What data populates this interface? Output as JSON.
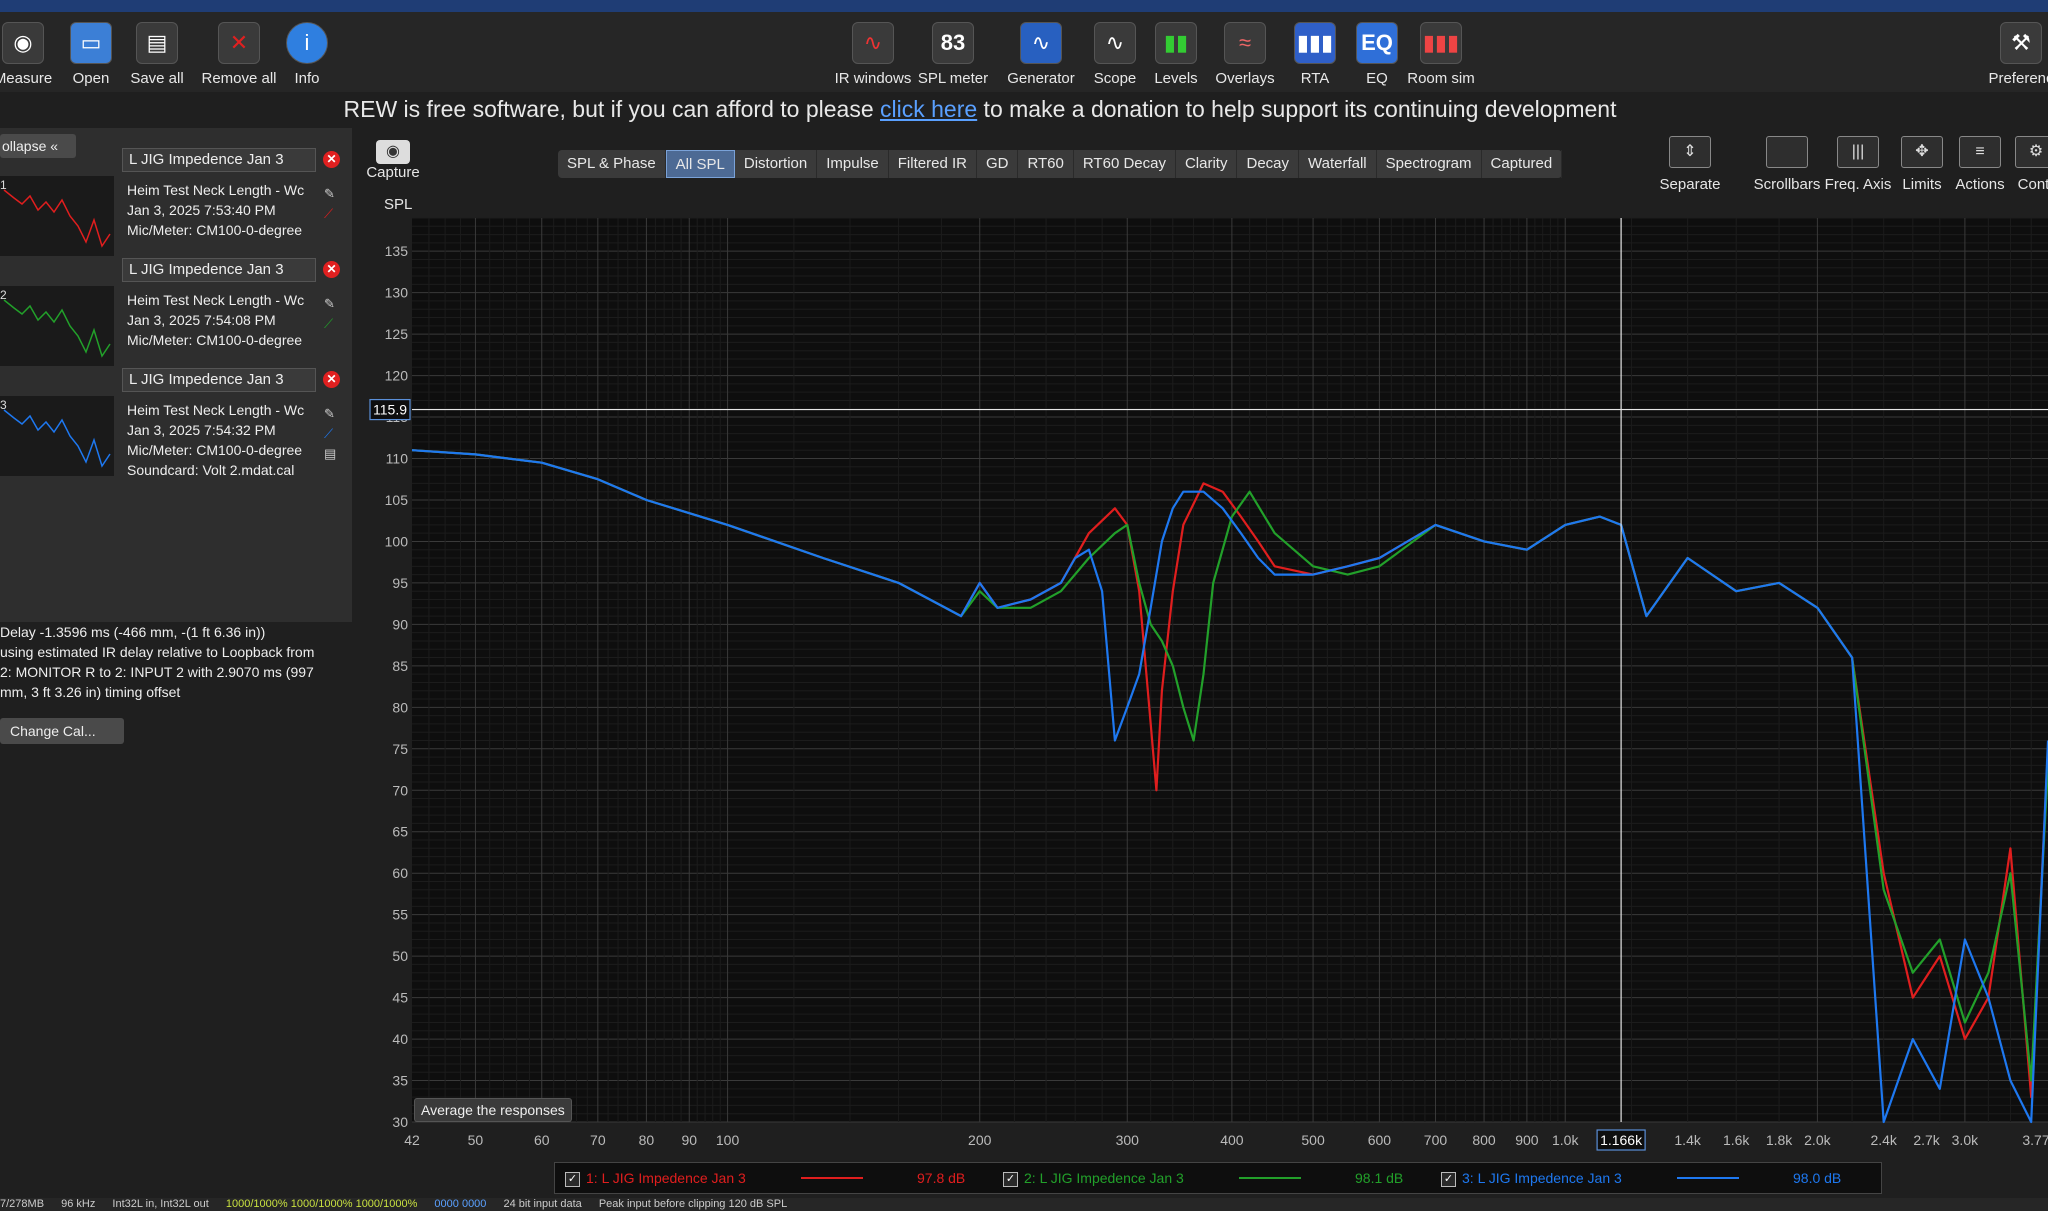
{
  "toolbar": {
    "left": [
      {
        "label": "Measure",
        "icon": "measure-icon"
      },
      {
        "label": "Open",
        "icon": "folder-icon"
      },
      {
        "label": "Save all",
        "icon": "save-icon"
      },
      {
        "label": "Remove all",
        "icon": "remove-icon"
      },
      {
        "label": "Info",
        "icon": "info-icon"
      }
    ],
    "center": [
      {
        "label": "IR windows",
        "icon": "ir-windows-icon"
      },
      {
        "label": "SPL meter",
        "icon": "spl-meter-icon",
        "value": "83"
      },
      {
        "label": "Generator",
        "icon": "generator-icon"
      },
      {
        "label": "Scope",
        "icon": "scope-icon"
      },
      {
        "label": "Levels",
        "icon": "levels-icon"
      },
      {
        "label": "Overlays",
        "icon": "overlays-icon"
      },
      {
        "label": "RTA",
        "icon": "rta-icon"
      },
      {
        "label": "EQ",
        "icon": "eq-icon"
      },
      {
        "label": "Room sim",
        "icon": "room-sim-icon"
      }
    ],
    "right": {
      "label": "Preferenc",
      "icon": "preferences-icon"
    }
  },
  "donate": {
    "before": "REW is free software, but if you can afford to please ",
    "link": "click here",
    "after": " to make a donation to help support its continuing development"
  },
  "left_panel": {
    "collapse_label": "ollapse «",
    "measurements": [
      {
        "index": "1",
        "name": "L JIG Impedence Jan 3",
        "lines": [
          "Heim Test Neck Length - Wc",
          "Jan 3, 2025 7:53:40 PM",
          "Mic/Meter: CM100-0-degree"
        ],
        "color": "#e01e1e"
      },
      {
        "index": "2",
        "name": "L JIG Impedence Jan 3",
        "lines": [
          "Heim Test Neck Length - Wc",
          "Jan 3, 2025 7:54:08 PM",
          "Mic/Meter: CM100-0-degree"
        ],
        "color": "#22a02a"
      },
      {
        "index": "3",
        "name": "L JIG Impedence Jan 3",
        "lines": [
          "Heim Test Neck Length - Wc",
          "Jan 3, 2025 7:54:32 PM",
          "Mic/Meter: CM100-0-degree",
          "Soundcard: Volt 2.mdat.cal"
        ],
        "color": "#1e78f0"
      }
    ],
    "delay_lines": [
      "Delay -1.3596 ms (-466 mm, -(1 ft 6.36 in))",
      "using estimated IR delay relative to Loopback from",
      "2: MONITOR R to 2: INPUT 2 with 2.9070 ms (997",
      "mm, 3 ft 3.26 in) timing offset"
    ],
    "change_cal": "Change Cal..."
  },
  "capture_label": "Capture",
  "spl_label": "SPL",
  "tabs": [
    "SPL & Phase",
    "All SPL",
    "Distortion",
    "Impulse",
    "Filtered IR",
    "GD",
    "RT60",
    "RT60 Decay",
    "Clarity",
    "Decay",
    "Waterfall",
    "Spectrogram",
    "Captured"
  ],
  "active_tab": "All SPL",
  "right_tools": [
    {
      "label": "Separate",
      "icon": "separate-icon"
    },
    {
      "label": "Scrollbars",
      "icon": "scrollbars-icon"
    },
    {
      "label": "Freq. Axis",
      "icon": "freq-axis-icon"
    },
    {
      "label": "Limits",
      "icon": "limits-icon"
    },
    {
      "label": "Actions",
      "icon": "actions-icon"
    },
    {
      "label": "Contr",
      "icon": "controls-icon"
    }
  ],
  "average_button": "Average the responses",
  "cursor": {
    "y_label": "115.9",
    "x_label": "1.166k",
    "freq": 1166,
    "spl": 115.9
  },
  "chart_data": {
    "type": "line",
    "x_scale": "log",
    "xlim": [
      42,
      3770
    ],
    "ylim": [
      30,
      139
    ],
    "y_ticks": [
      30,
      35,
      40,
      45,
      50,
      55,
      60,
      65,
      70,
      75,
      80,
      85,
      90,
      95,
      100,
      105,
      110,
      115,
      120,
      125,
      130,
      135
    ],
    "x_ticks": [
      {
        "v": 42,
        "l": "42"
      },
      {
        "v": 50,
        "l": "50"
      },
      {
        "v": 60,
        "l": "60"
      },
      {
        "v": 70,
        "l": "70"
      },
      {
        "v": 80,
        "l": "80"
      },
      {
        "v": 90,
        "l": "90"
      },
      {
        "v": 100,
        "l": "100"
      },
      {
        "v": 200,
        "l": "200"
      },
      {
        "v": 300,
        "l": "300"
      },
      {
        "v": 400,
        "l": "400"
      },
      {
        "v": 500,
        "l": "500"
      },
      {
        "v": 600,
        "l": "600"
      },
      {
        "v": 700,
        "l": "700"
      },
      {
        "v": 800,
        "l": "800"
      },
      {
        "v": 900,
        "l": "900"
      },
      {
        "v": 1000,
        "l": "1.0k"
      },
      {
        "v": 1400,
        "l": "1.4k"
      },
      {
        "v": 1600,
        "l": "1.6k"
      },
      {
        "v": 1800,
        "l": "1.8k"
      },
      {
        "v": 2000,
        "l": "2.0k"
      },
      {
        "v": 2400,
        "l": "2.4k"
      },
      {
        "v": 2700,
        "l": "2.7k"
      },
      {
        "v": 3000,
        "l": "3.0k"
      },
      {
        "v": 3770,
        "l": "3.77"
      }
    ],
    "grid": true,
    "series": [
      {
        "name": "1: L JIG Impedence Jan 3",
        "color": "#e01e1e",
        "level": "97.8 dB",
        "x": [
          42,
          50,
          60,
          70,
          80,
          100,
          130,
          160,
          190,
          200,
          210,
          230,
          250,
          270,
          290,
          300,
          310,
          320,
          325,
          330,
          340,
          350,
          370,
          390,
          410,
          430,
          450,
          500,
          550,
          600,
          700,
          800,
          900,
          1000,
          1100,
          1166,
          1250,
          1400,
          1600,
          1800,
          2000,
          2200,
          2400,
          2600,
          2800,
          3000,
          3200,
          3400,
          3600,
          3770
        ],
        "y": [
          111,
          110.5,
          109.5,
          107.5,
          105,
          102,
          98,
          95,
          91,
          95,
          92,
          93,
          95,
          101,
          104,
          102,
          94,
          78,
          70,
          82,
          94,
          102,
          107,
          106,
          103,
          100,
          97,
          96,
          97,
          98,
          102,
          100,
          99,
          102,
          103,
          102,
          91,
          98,
          94,
          95,
          92,
          86,
          60,
          45,
          50,
          40,
          45,
          63,
          33,
          75
        ]
      },
      {
        "name": "2: L JIG Impedence Jan 3",
        "color": "#22a02a",
        "level": "98.1 dB",
        "x": [
          42,
          50,
          60,
          70,
          80,
          100,
          130,
          160,
          190,
          200,
          210,
          230,
          250,
          270,
          290,
          300,
          310,
          320,
          330,
          340,
          350,
          360,
          370,
          380,
          400,
          420,
          450,
          500,
          550,
          600,
          700,
          800,
          900,
          1000,
          1100,
          1166,
          1250,
          1400,
          1600,
          1800,
          2000,
          2200,
          2400,
          2600,
          2800,
          3000,
          3200,
          3400,
          3600,
          3770
        ],
        "y": [
          111,
          110.5,
          109.5,
          107.5,
          105,
          102,
          98,
          95,
          91,
          94,
          92,
          92,
          94,
          98,
          101,
          102,
          95,
          90,
          88,
          85,
          80,
          76,
          84,
          95,
          103,
          106,
          101,
          97,
          96,
          97,
          102,
          100,
          99,
          102,
          103,
          102,
          91,
          98,
          94,
          95,
          92,
          86,
          58,
          48,
          52,
          42,
          48,
          60,
          35,
          73
        ]
      },
      {
        "name": "3: L JIG Impedence Jan 3",
        "color": "#1e78f0",
        "level": "98.0 dB",
        "x": [
          42,
          50,
          60,
          70,
          80,
          100,
          130,
          160,
          190,
          200,
          210,
          230,
          250,
          260,
          270,
          280,
          290,
          300,
          310,
          320,
          330,
          340,
          350,
          370,
          390,
          410,
          430,
          450,
          500,
          550,
          600,
          700,
          800,
          900,
          1000,
          1100,
          1166,
          1250,
          1400,
          1600,
          1800,
          2000,
          2200,
          2400,
          2600,
          2800,
          3000,
          3200,
          3400,
          3600,
          3770
        ],
        "y": [
          111,
          110.5,
          109.5,
          107.5,
          105,
          102,
          98,
          95,
          91,
          95,
          92,
          93,
          95,
          98,
          99,
          94,
          76,
          80,
          84,
          92,
          100,
          104,
          106,
          106,
          104,
          101,
          98,
          96,
          96,
          97,
          98,
          102,
          100,
          99,
          102,
          103,
          102,
          91,
          98,
          94,
          95,
          92,
          86,
          30,
          40,
          34,
          52,
          45,
          35,
          30,
          76
        ]
      }
    ]
  },
  "legend": [
    {
      "label": "1: L JIG Impedence Jan 3",
      "color": "#e01e1e",
      "level": "97.8 dB",
      "checked": "✓"
    },
    {
      "label": "2: L JIG Impedence Jan 3",
      "color": "#22a02a",
      "level": "98.1 dB",
      "checked": "✓"
    },
    {
      "label": "3: L JIG Impedence Jan 3",
      "color": "#1e78f0",
      "level": "98.0 dB",
      "checked": "✓"
    }
  ],
  "status": {
    "mem": "7/278MB",
    "rate": "96 kHz",
    "fmt": "Int32L in, Int32L out",
    "levels": "1000/1000% 1000/1000% 1000/1000%",
    "zero": "0000 0000",
    "bits": "24 bit input data",
    "peak": "Peak input before clipping 120 dB SPL"
  }
}
